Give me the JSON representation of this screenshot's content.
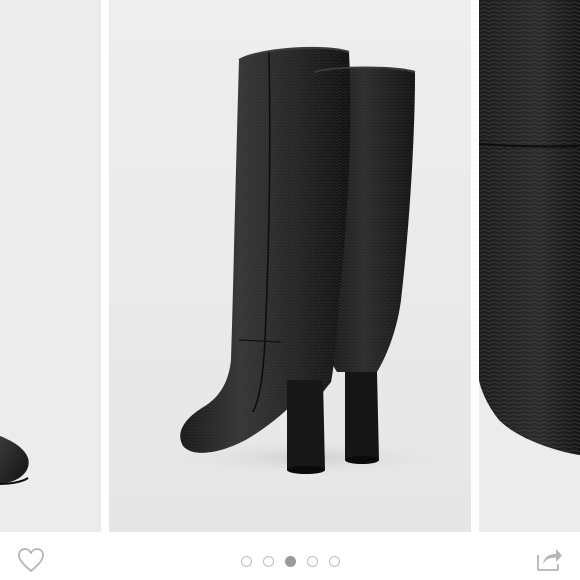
{
  "carousel": {
    "slide_count": 5,
    "active_index": 2,
    "slides": [
      {
        "name": "slide-previous",
        "icon": "boot-toe-image"
      },
      {
        "name": "slide-current",
        "icon": "knee-high-boots-image"
      },
      {
        "name": "slide-next",
        "icon": "snakeskin-texture-closeup-image"
      }
    ]
  },
  "actions": {
    "favorite_icon": "heart-outline-icon",
    "share_icon": "share-arrow-icon"
  },
  "colors": {
    "background": "#ffffff",
    "slide_bg": "#ececec",
    "boot": "#1e1e1e",
    "dot_inactive": "#bdbdbd",
    "dot_active": "#9a9a9a",
    "icon": "#b5b5b5"
  }
}
